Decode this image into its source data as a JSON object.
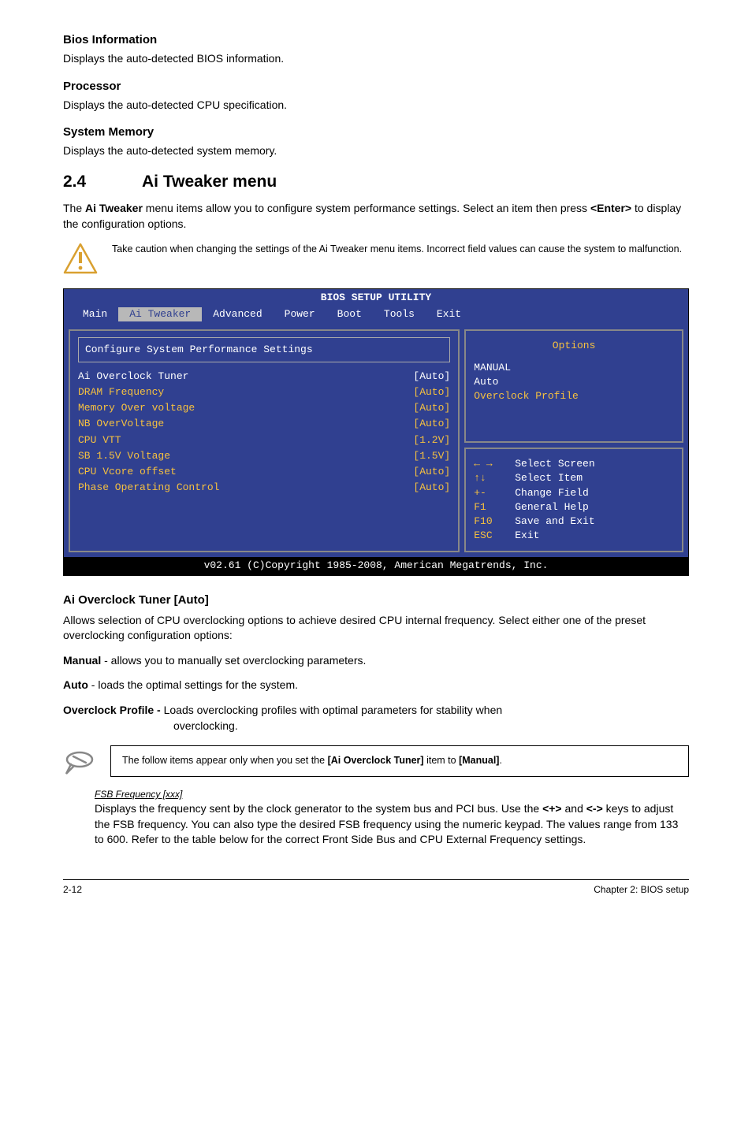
{
  "sections": {
    "bios_info_title": "Bios Information",
    "bios_info_text": "Displays the auto-detected BIOS information.",
    "processor_title": "Processor",
    "processor_text": "Displays the auto-detected CPU specification.",
    "sysmem_title": "System Memory",
    "sysmem_text": "Displays the auto-detected system memory."
  },
  "main_heading": {
    "num": "2.4",
    "title": "Ai Tweaker menu"
  },
  "intro": {
    "part1": "The ",
    "bold1": "Ai Tweaker",
    "part2": " menu items allow you to configure system performance settings. Select an item then press ",
    "bold2": "<Enter>",
    "part3": " to display the configuration options."
  },
  "caution_text": "Take caution when changing the settings of the Ai Tweaker menu items. Incorrect field values can cause the system to malfunction.",
  "bios": {
    "title": "BIOS SETUP UTILITY",
    "menus": [
      "Main",
      "Ai Tweaker",
      "Advanced",
      "Power",
      "Boot",
      "Tools",
      "Exit"
    ],
    "selected_menu": "Ai Tweaker",
    "group_label": "Configure System Performance Settings",
    "rows": [
      {
        "label": "Ai Overclock Tuner",
        "value": "[Auto]",
        "hi": true
      },
      {
        "label": "DRAM Frequency",
        "value": "[Auto]",
        "hi": false
      },
      {
        "label": "Memory Over voltage",
        "value": "[Auto]",
        "hi": false
      },
      {
        "label": "NB OverVoltage",
        "value": "[Auto]",
        "hi": false
      },
      {
        "label": "CPU VTT",
        "value": "[1.2V]",
        "hi": false
      },
      {
        "label": "SB 1.5V Voltage",
        "value": "[1.5V]",
        "hi": false
      },
      {
        "label": "CPU Vcore offset",
        "value": "[Auto]",
        "hi": false
      },
      {
        "label": "Phase Operating Control",
        "value": "[Auto]",
        "hi": false
      }
    ],
    "options_title": "Options",
    "options": [
      {
        "label": "MANUAL",
        "hi": false
      },
      {
        "label": "Auto",
        "hi": false
      },
      {
        "label": "Overclock Profile",
        "hi": true
      }
    ],
    "help": [
      {
        "key": "← →",
        "label": "Select Screen"
      },
      {
        "key": "↑↓",
        "label": "Select Item"
      },
      {
        "key": "+-",
        "label": "Change Field"
      },
      {
        "key": "F1",
        "label": "General Help"
      },
      {
        "key": "F10",
        "label": "Save and Exit"
      },
      {
        "key": "ESC",
        "label": "Exit"
      }
    ],
    "footer": "v02.61 (C)Copyright 1985-2008, American Megatrends, Inc."
  },
  "overclock": {
    "title": "Ai Overclock Tuner [Auto]",
    "desc": "Allows selection of CPU overclocking options to achieve desired CPU internal frequency. Select either one of the preset overclocking configuration options:",
    "manual_b": "Manual",
    "manual_t": " - allows you to manually set overclocking parameters.",
    "auto_b": "Auto",
    "auto_t": " - loads the optimal settings for the system.",
    "ocp_b": "Overclock Profile - ",
    "ocp_t1": "Loads overclocking profiles with optimal parameters for stability when",
    "ocp_t2": "overclocking."
  },
  "note": {
    "part1": "The follow items appear only when you set the ",
    "bold1": "[Ai Overclock Tuner]",
    "part2": " item to ",
    "bold2": "[Manual]",
    "part3": "."
  },
  "fsb": {
    "title": "FSB Frequency [xxx]",
    "p1": "Displays the frequency sent by the clock generator to the system bus and PCI bus. Use the ",
    "b1": "<+>",
    "p2": " and ",
    "b2": "<->",
    "p3": " keys to adjust the FSB frequency. You can also type the desired FSB frequency using the numeric keypad. The values range from 133 to 600. Refer to the table below for the correct Front Side Bus and CPU External Frequency settings."
  },
  "footer": {
    "left": "2-12",
    "right": "Chapter 2: BIOS setup"
  }
}
